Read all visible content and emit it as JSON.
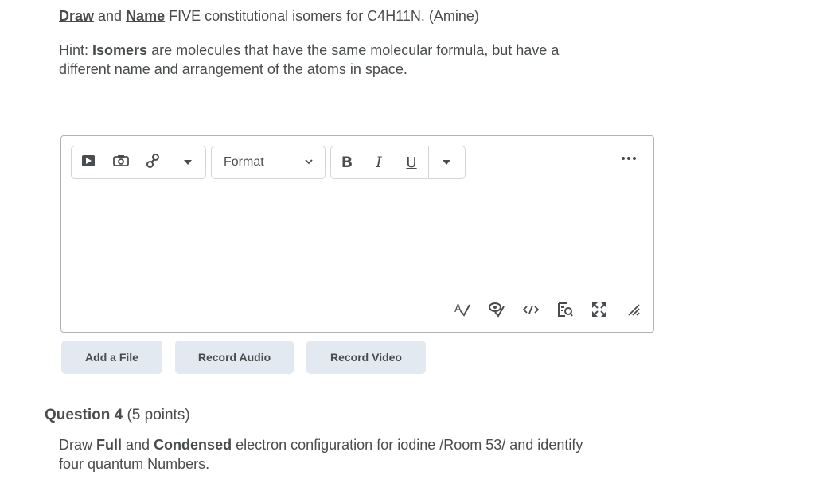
{
  "question": {
    "draw_word": "Draw",
    "and_word": " and ",
    "name_word": "Name",
    "rest": " FIVE  constitutional isomers for C4H11N. (Amine)",
    "hint_label": "Hint: ",
    "hint_bold": "Isomers",
    "hint_rest_1": " are molecules that have the same molecular formula, but have a",
    "hint_rest_2": "different name and arrangement of the atoms in space."
  },
  "toolbar": {
    "format_label": "Format",
    "bold_label": "B",
    "italic_label": "I",
    "underline_label": "U",
    "icons": {
      "insert_stuff": "play-icon",
      "insert_image": "camera-icon",
      "insert_link": "link-icon",
      "more_insert": "caret-down-icon",
      "more_format": "caret-down-icon",
      "more_actions": "ellipsis-icon",
      "spellcheck": "spellcheck-icon",
      "accessibility": "accessibility-check-icon",
      "source_code": "code-icon",
      "preview": "preview-icon",
      "fullscreen": "fullscreen-icon",
      "resize": "resize-handle-icon"
    }
  },
  "actions": {
    "add_file": "Add a File",
    "record_audio": "Record Audio",
    "record_video": "Record Video"
  },
  "question4": {
    "title_bold": "Question 4",
    "points": " (5 points)",
    "line1_a": "Draw ",
    "line1_full": "Full",
    "line1_b": " and ",
    "line1_condensed": "Condensed",
    "line1_c": " electron configuration for iodine /Room 53/ and identify",
    "line2": "four quantum Numbers."
  }
}
